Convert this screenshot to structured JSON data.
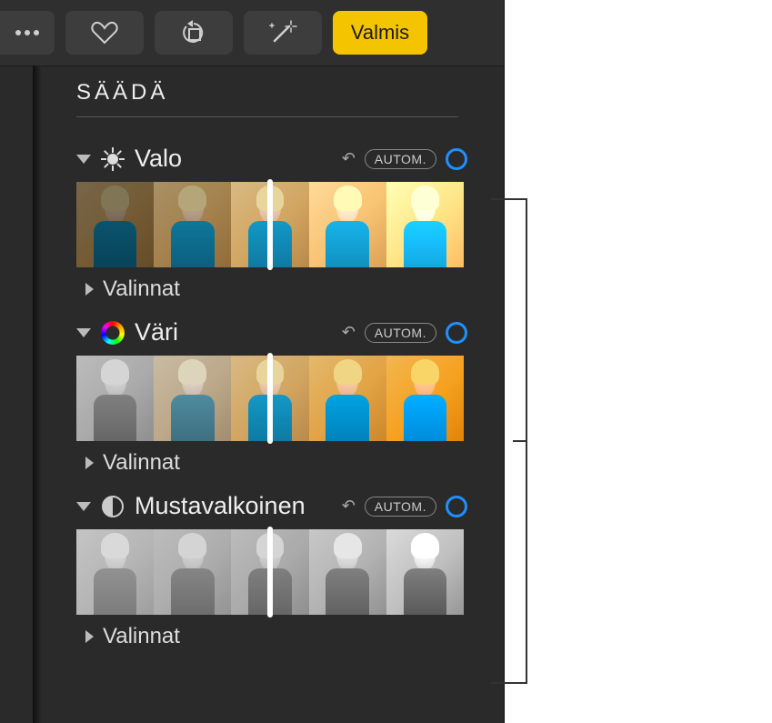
{
  "toolbar": {
    "done_label": "Valmis"
  },
  "heading": "SÄÄDÄ",
  "sections": {
    "light": {
      "title": "Valo",
      "auto": "AUTOM.",
      "options": "Valinnat"
    },
    "color": {
      "title": "Väri",
      "auto": "AUTOM.",
      "options": "Valinnat"
    },
    "bw": {
      "title": "Mustavalkoinen",
      "auto": "AUTOM.",
      "options": "Valinnat"
    }
  }
}
